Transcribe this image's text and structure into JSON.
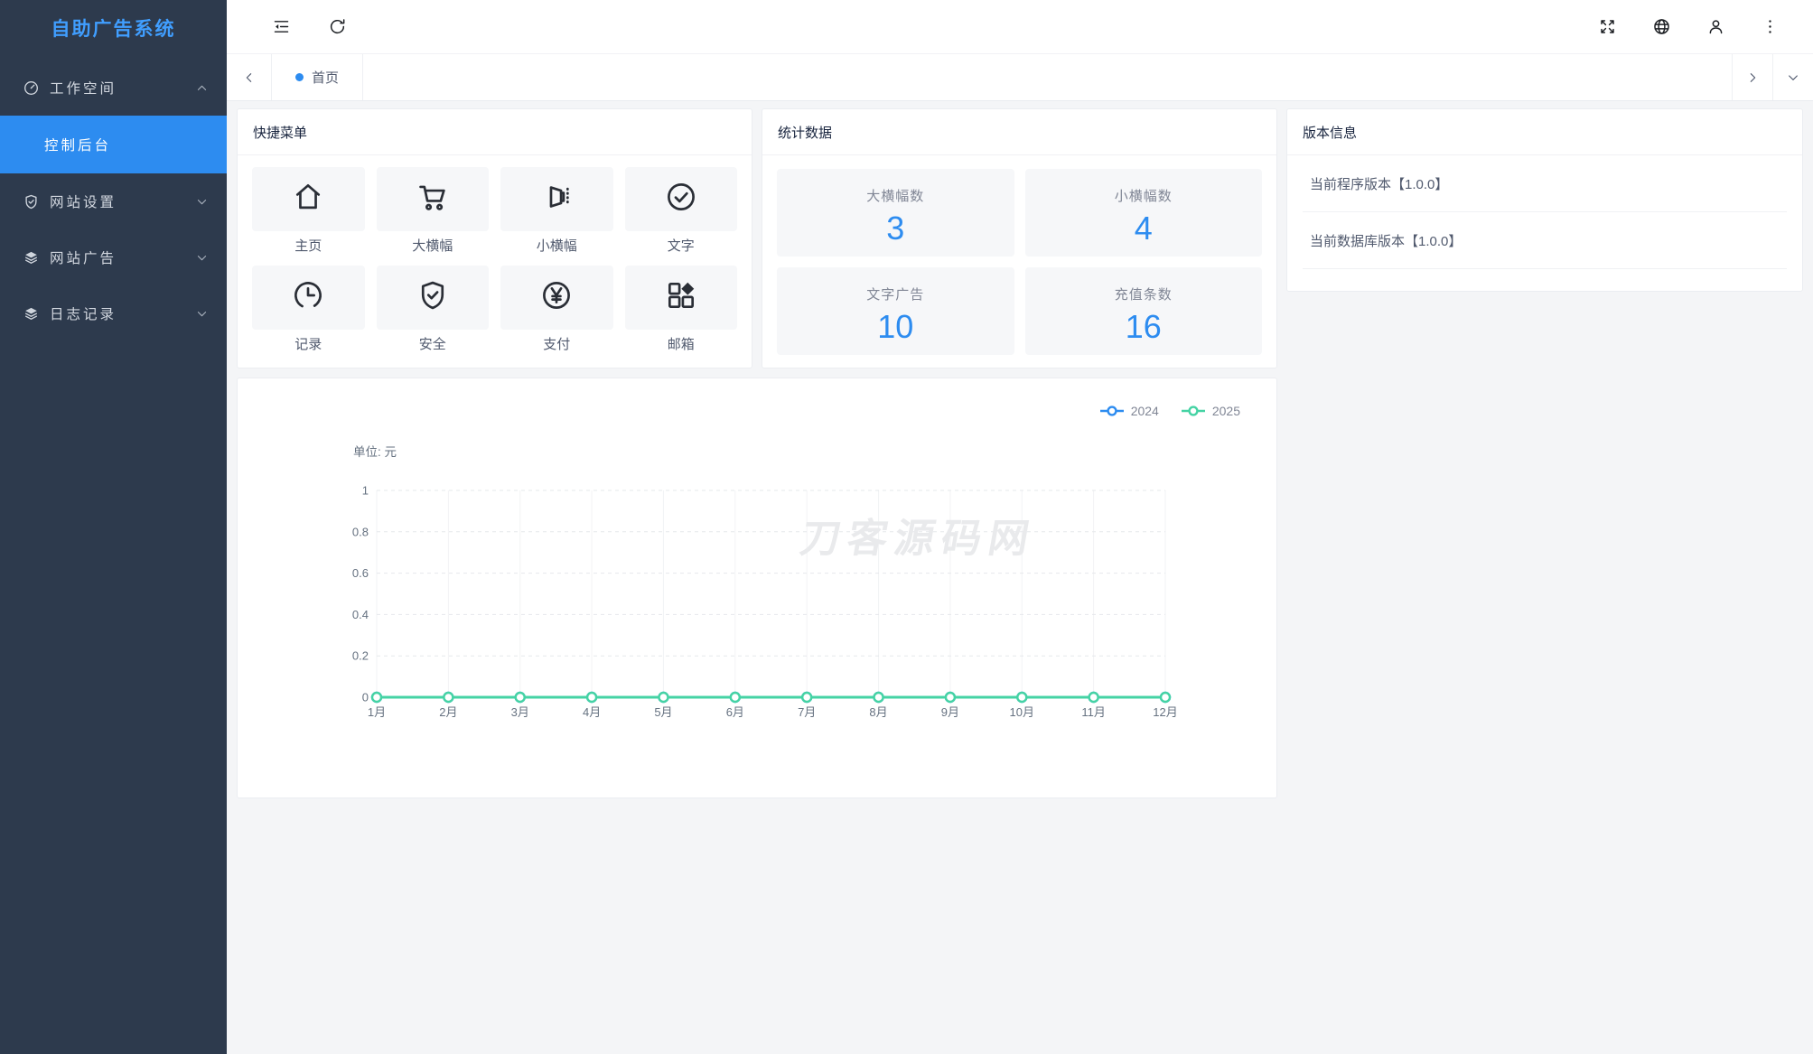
{
  "app": {
    "title": "自助广告系统"
  },
  "header": {
    "left_icons": [
      {
        "name": "collapse-sidebar-icon",
        "icon": "collapse-icon"
      },
      {
        "name": "refresh-icon",
        "icon": "refresh-icon"
      }
    ],
    "right_icons": [
      {
        "name": "fullscreen-icon",
        "icon": "fullscreen-icon"
      },
      {
        "name": "language-globe-icon",
        "icon": "globe-icon"
      },
      {
        "name": "user-icon",
        "icon": "user-icon"
      },
      {
        "name": "more-options-icon",
        "icon": "more-icon"
      }
    ]
  },
  "sidebar": {
    "menu": [
      {
        "label": "工作空间",
        "icon": "dashboard-icon",
        "state": "expanded",
        "children": [
          {
            "label": "控制后台",
            "active": true
          }
        ]
      },
      {
        "label": "网站设置",
        "icon": "shield-check-icon",
        "state": "collapsed"
      },
      {
        "label": "网站广告",
        "icon": "layers-icon",
        "state": "collapsed"
      },
      {
        "label": "日志记录",
        "icon": "layers-icon",
        "state": "collapsed"
      }
    ]
  },
  "tabbar": {
    "tabs": [
      {
        "label": "首页",
        "active": true
      }
    ]
  },
  "quick_menu": {
    "title": "快捷菜单",
    "items": [
      {
        "label": "主页",
        "icon": "home-icon"
      },
      {
        "label": "大横幅",
        "icon": "cart-icon"
      },
      {
        "label": "小横幅",
        "icon": "banner-icon"
      },
      {
        "label": "文字",
        "icon": "check-circle-icon"
      },
      {
        "label": "记录",
        "icon": "clock-icon"
      },
      {
        "label": "安全",
        "icon": "shield-check-icon"
      },
      {
        "label": "支付",
        "icon": "yen-circle-icon"
      },
      {
        "label": "邮箱",
        "icon": "grid-icon"
      }
    ]
  },
  "stats": {
    "title": "统计数据",
    "items": [
      {
        "label": "大横幅数",
        "value": "3"
      },
      {
        "label": "小横幅数",
        "value": "4"
      },
      {
        "label": "文字广告",
        "value": "10"
      },
      {
        "label": "充值条数",
        "value": "16"
      }
    ]
  },
  "version": {
    "title": "版本信息",
    "items": [
      "当前程序版本【1.0.0】",
      "当前数据库版本【1.0.0】"
    ]
  },
  "chart_data": {
    "type": "line",
    "unit_label": "单位: 元",
    "x": [
      "1月",
      "2月",
      "3月",
      "4月",
      "5月",
      "6月",
      "7月",
      "8月",
      "9月",
      "10月",
      "11月",
      "12月"
    ],
    "series": [
      {
        "name": "2024",
        "color": "#2d8cf0",
        "values": [
          0,
          0,
          0,
          0,
          0,
          0,
          0,
          0,
          0,
          0,
          0,
          0
        ]
      },
      {
        "name": "2025",
        "color": "#45d3a4",
        "values": [
          0,
          0,
          0,
          0,
          0,
          0,
          0,
          0,
          0,
          0,
          0,
          0
        ]
      }
    ],
    "ylim": [
      0,
      1
    ],
    "yticks": [
      0,
      0.2,
      0.4,
      0.6,
      0.8,
      1
    ],
    "legend_position": "top-right",
    "grid": true,
    "watermark": "刀客源码网"
  },
  "colors": {
    "accent": "#2d8cf0",
    "logo_text": "#409eff",
    "sidebar_bg": "#2d3a4d",
    "sidebar_submenu_bg": "#232d3c",
    "active_item_bg": "#2d8cf0",
    "stat_value": "#2d8cf0",
    "watermark_gray": "#e9eaec"
  }
}
